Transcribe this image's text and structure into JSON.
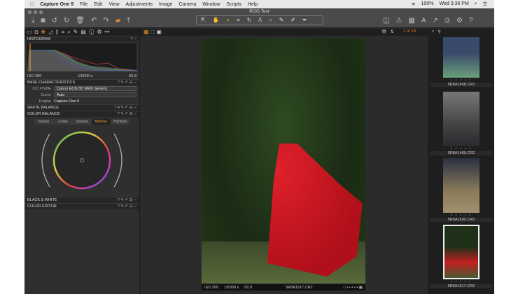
{
  "menubar": {
    "app": "Capture One 9",
    "items": [
      "File",
      "Edit",
      "View",
      "Adjustments",
      "Image",
      "Camera",
      "Window",
      "Scripts",
      "Help"
    ],
    "battery": "100%",
    "clock": "Wed 3:36 PM"
  },
  "window": {
    "title": "RGG Test"
  },
  "browser_header": {
    "counter": "1 of 15"
  },
  "histogram": {
    "title": "HISTOGRAM",
    "iso": "ISO 200",
    "shutter": "1/5000 s",
    "aperture": "f/2.8"
  },
  "base": {
    "title": "BASE CHARACTERISTICS",
    "icc_label": "ICC Profile",
    "icc_value": "Canon EOS-5D MkIII Generic",
    "curve_label": "Curve",
    "curve_value": "Auto",
    "engine_label": "Engine",
    "engine_value": "Capture One 9"
  },
  "white_balance": {
    "title": "WHITE BALANCE"
  },
  "color_balance": {
    "title": "COLOR BALANCE",
    "tabs": [
      "Master",
      "3-Way",
      "Shadow",
      "Midtone",
      "Highlight"
    ],
    "active": "Midtone"
  },
  "black_white": {
    "title": "BLACK & WHITE"
  },
  "color_editor": {
    "title": "COLOR EDITOR"
  },
  "viewer": {
    "iso": "ISO 200",
    "shutter": "1/5000 s",
    "aperture": "f/2.8",
    "filename": "5R8A1917.CR2"
  },
  "thumbnails": [
    {
      "name": "5R8A1408.CR2",
      "color": "#5a8a6a"
    },
    {
      "name": "5R8A1489.CR2",
      "color": "#5a5a5a"
    },
    {
      "name": "5R8A1590.CR2",
      "color": "#6a5a40"
    },
    {
      "name": "5R8A1917.CR2",
      "color": "#7a2a20",
      "selected": true
    }
  ]
}
